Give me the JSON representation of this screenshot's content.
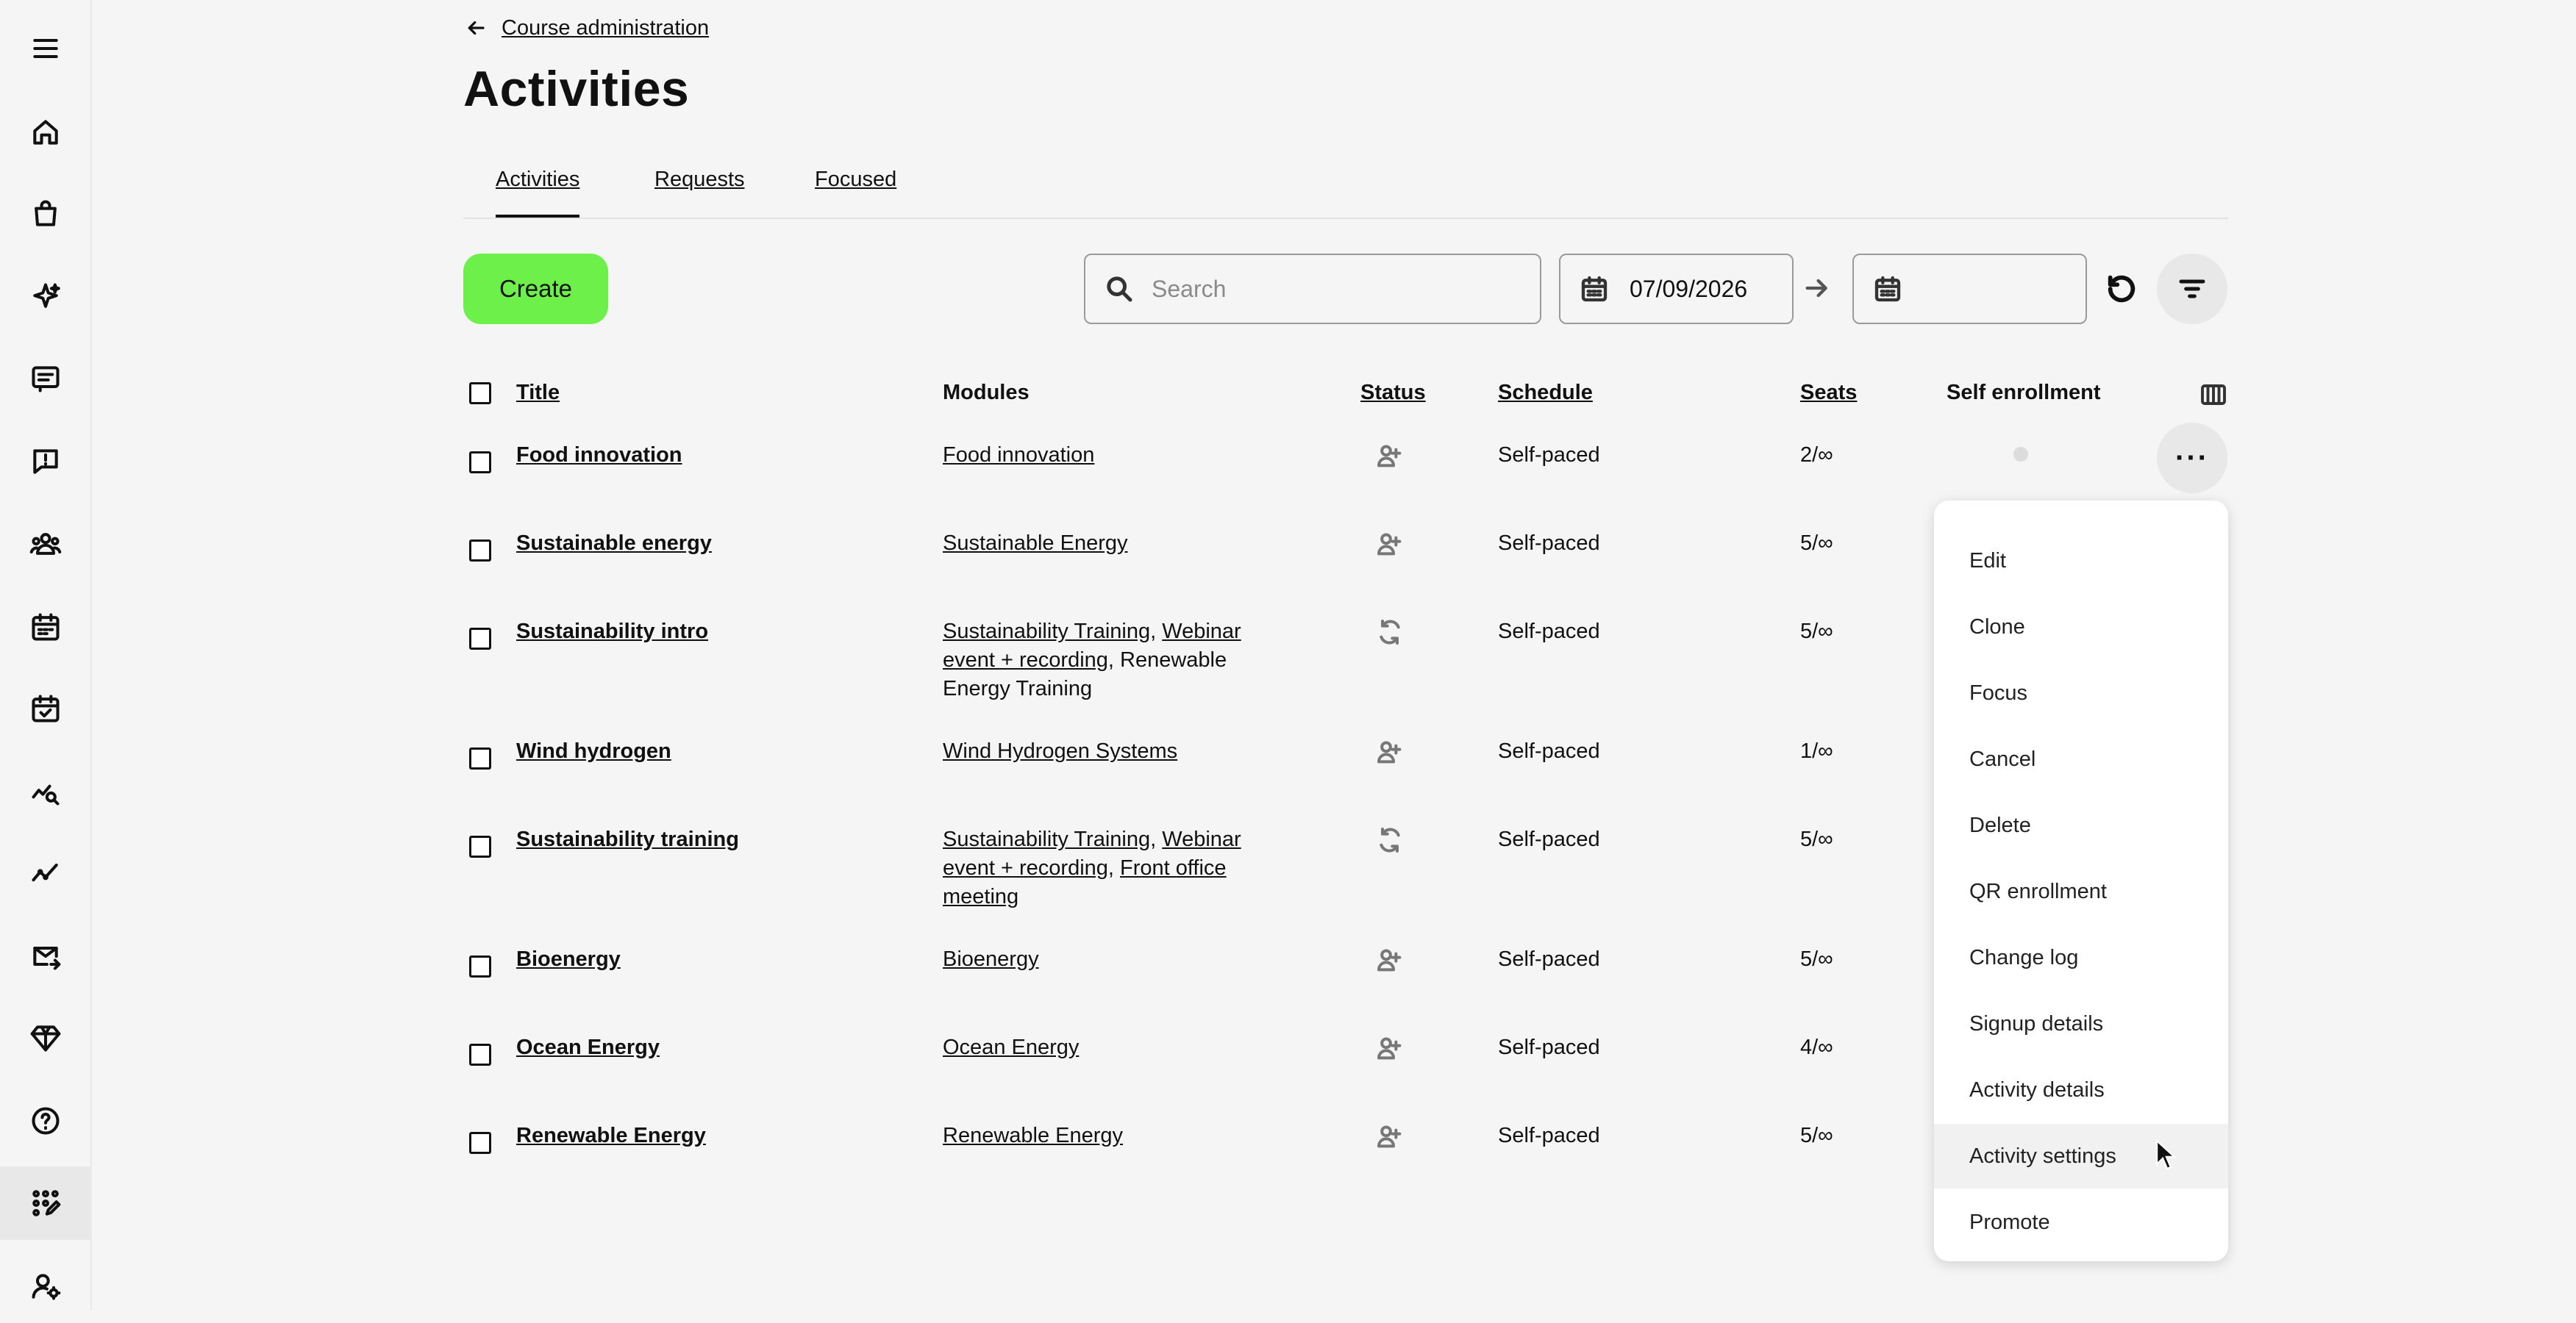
{
  "sidebar": {
    "items": [
      {
        "icon": "menu-icon"
      },
      {
        "icon": "home-icon"
      },
      {
        "icon": "shopping-bag-icon"
      },
      {
        "icon": "sparkles-icon"
      },
      {
        "icon": "message-list-icon"
      },
      {
        "icon": "alert-message-icon"
      },
      {
        "icon": "users-group-icon"
      },
      {
        "icon": "calendar-icon"
      },
      {
        "icon": "calendar-check-icon"
      },
      {
        "icon": "trend-search-icon"
      },
      {
        "icon": "trend-line-icon"
      },
      {
        "icon": "mail-forward-icon"
      },
      {
        "icon": "diamond-icon"
      },
      {
        "icon": "help-icon"
      },
      {
        "icon": "apps-edit-icon",
        "active": true
      },
      {
        "icon": "user-settings-icon"
      }
    ]
  },
  "header": {
    "back_label": "Course administration",
    "title": "Activities"
  },
  "tabs": [
    {
      "label": "Activities",
      "active": true
    },
    {
      "label": "Requests"
    },
    {
      "label": "Focused"
    }
  ],
  "toolbar": {
    "create_label": "Create",
    "search_placeholder": "Search",
    "date_from": "07/09/2026",
    "date_to": ""
  },
  "table": {
    "headers": {
      "title": "Title",
      "modules": "Modules",
      "status": "Status",
      "schedule": "Schedule",
      "seats": "Seats",
      "self_enrollment": "Self enrollment"
    },
    "rows": [
      {
        "title": "Food innovation",
        "modules": [
          {
            "text": "Food innovation",
            "link": true
          }
        ],
        "status_icon": "user-plus-icon",
        "schedule": "Self-paced",
        "seats": "2/∞"
      },
      {
        "title": "Sustainable energy",
        "modules": [
          {
            "text": "Sustainable Energy",
            "link": true
          }
        ],
        "status_icon": "user-plus-icon",
        "schedule": "Self-paced",
        "seats": "5/∞"
      },
      {
        "title": "Sustainability intro",
        "modules": [
          {
            "text": "Sustainability Training",
            "link": true
          },
          {
            "text": ", ",
            "link": false
          },
          {
            "text": "Webinar event + recording",
            "link": true
          },
          {
            "text": ", Renewable Energy Training",
            "link": false
          }
        ],
        "status_icon": "refresh-icon",
        "schedule": "Self-paced",
        "seats": "5/∞"
      },
      {
        "title": "Wind hydrogen",
        "modules": [
          {
            "text": "Wind Hydrogen Systems",
            "link": true
          }
        ],
        "status_icon": "user-plus-icon",
        "schedule": "Self-paced",
        "seats": "1/∞"
      },
      {
        "title": "Sustainability training",
        "modules": [
          {
            "text": "Sustainability Training",
            "link": true
          },
          {
            "text": ", ",
            "link": false
          },
          {
            "text": "Webinar event + recording",
            "link": true
          },
          {
            "text": ", ",
            "link": false
          },
          {
            "text": "Front office meeting",
            "link": true
          }
        ],
        "status_icon": "refresh-icon",
        "schedule": "Self-paced",
        "seats": "5/∞"
      },
      {
        "title": "Bioenergy",
        "modules": [
          {
            "text": "Bioenergy",
            "link": true
          }
        ],
        "status_icon": "user-plus-icon",
        "schedule": "Self-paced",
        "seats": "5/∞"
      },
      {
        "title": "Ocean Energy",
        "modules": [
          {
            "text": "Ocean Energy",
            "link": true
          }
        ],
        "status_icon": "user-plus-icon",
        "schedule": "Self-paced",
        "seats": "4/∞"
      },
      {
        "title": "Renewable Energy",
        "modules": [
          {
            "text": "Renewable Energy",
            "link": true
          }
        ],
        "status_icon": "user-plus-icon",
        "schedule": "Self-paced",
        "seats": "5/∞"
      }
    ]
  },
  "context_menu": {
    "items": [
      "Edit",
      "Clone",
      "Focus",
      "Cancel",
      "Delete",
      "QR enrollment",
      "Change log",
      "Signup details",
      "Activity details",
      "Activity settings",
      "Promote"
    ],
    "hovered": "Activity settings"
  },
  "colors": {
    "accent": "#6ef04a",
    "background": "#f5f5f5"
  }
}
